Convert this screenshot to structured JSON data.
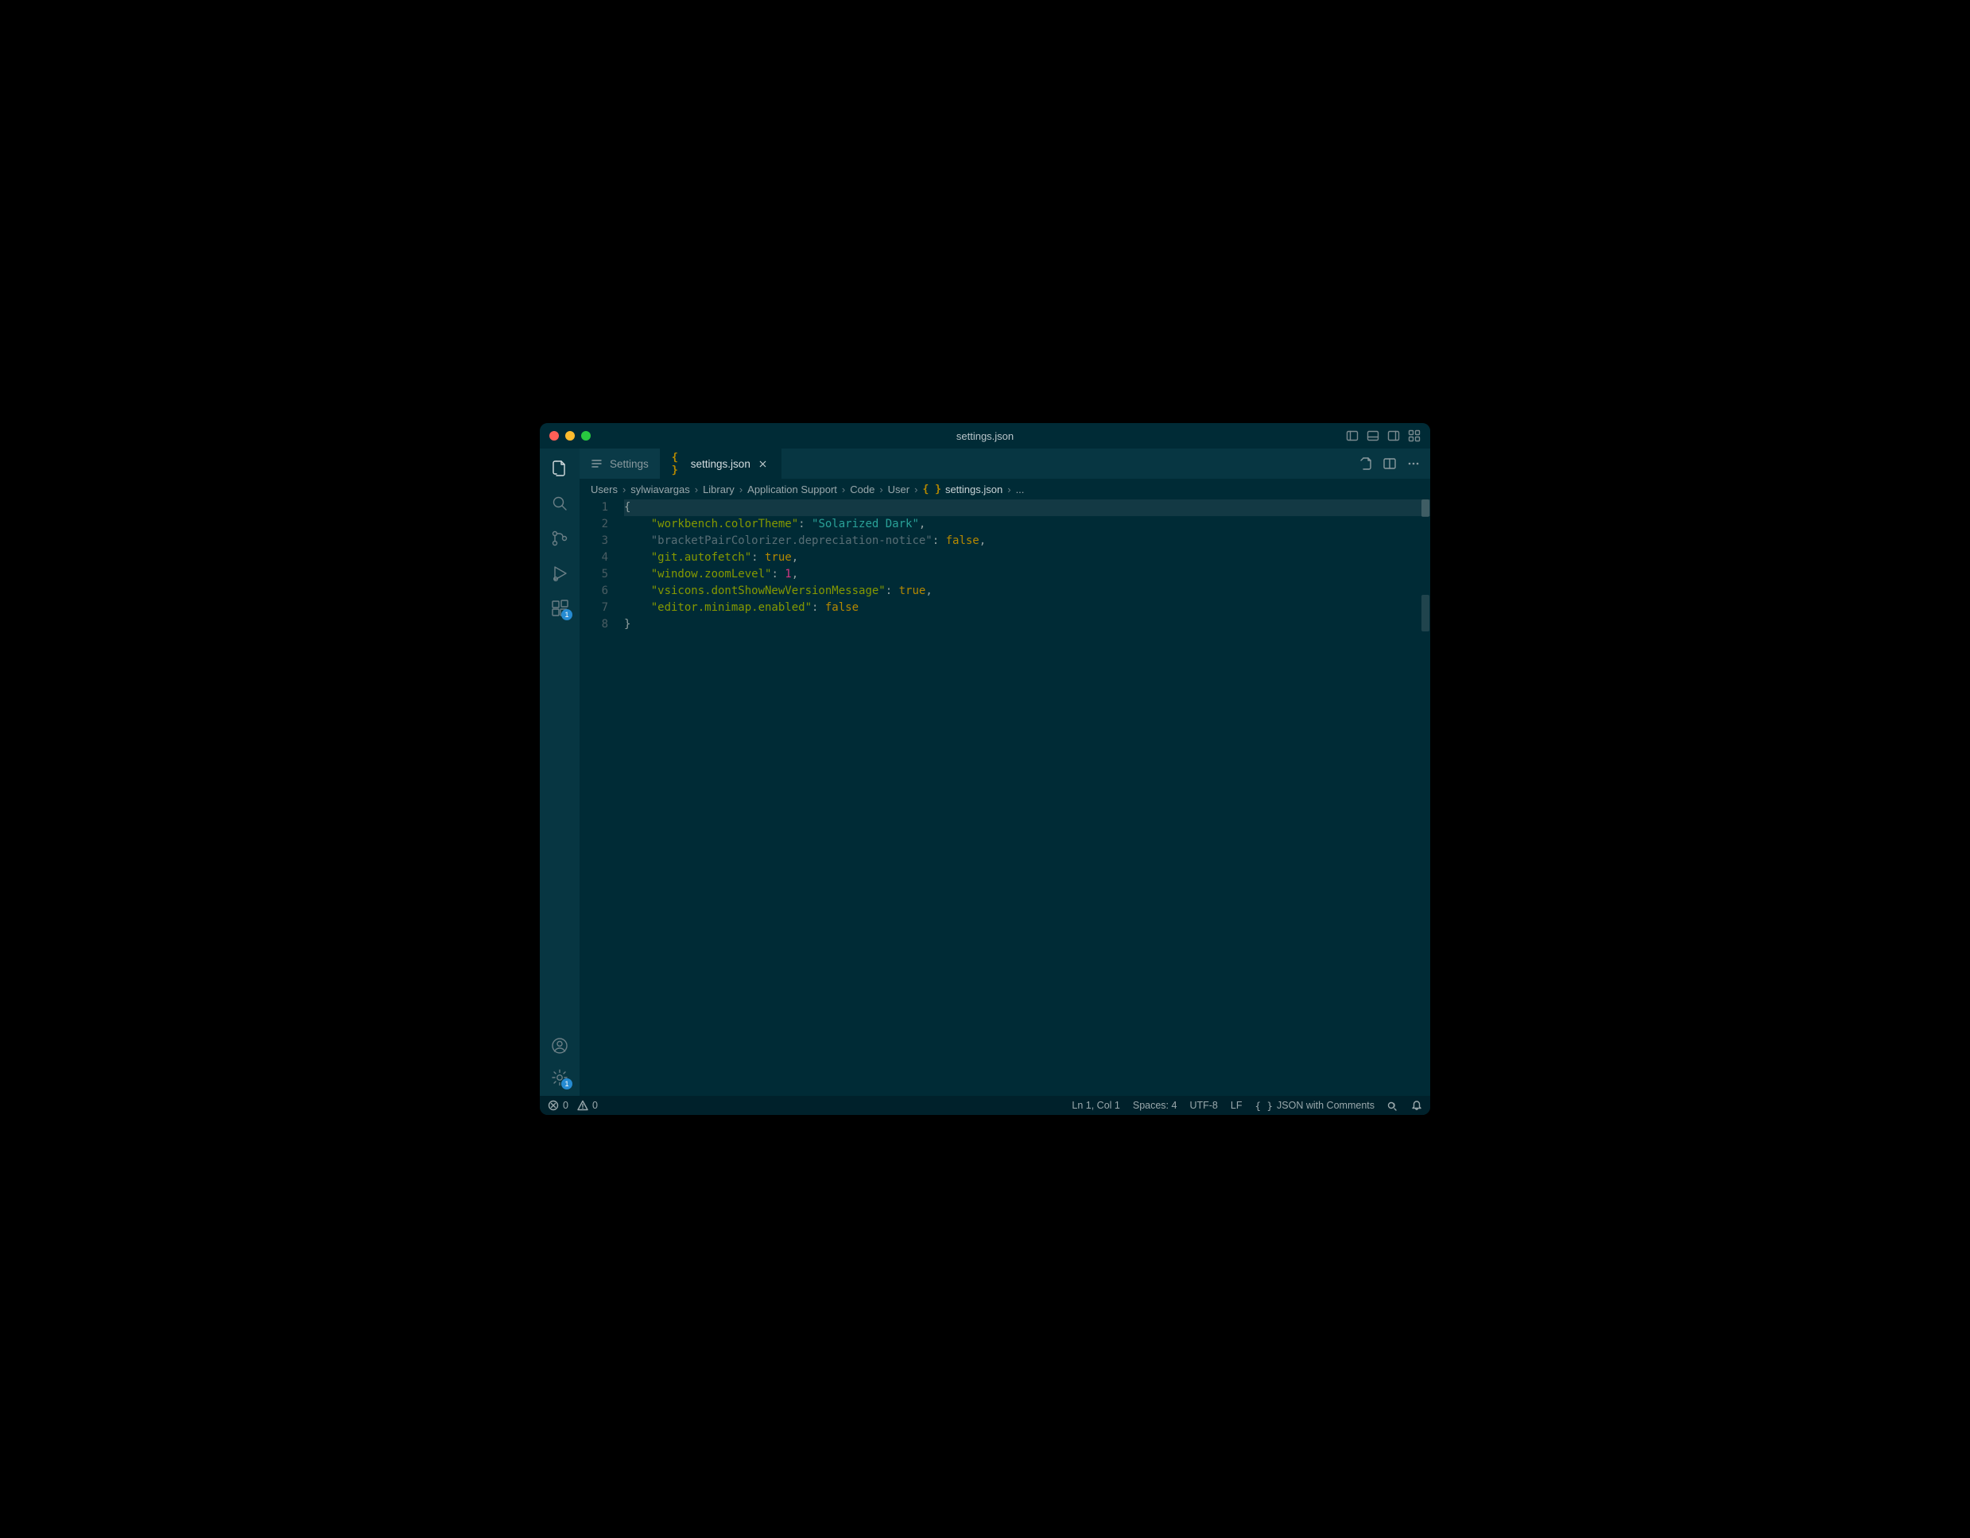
{
  "titlebar": {
    "title": "settings.json"
  },
  "tabs": [
    {
      "label": "Settings",
      "icon": "settings-list"
    },
    {
      "label": "settings.json",
      "icon": "json-braces"
    }
  ],
  "breadcrumbs": {
    "parts": [
      "Users",
      "sylwiavargas",
      "Library",
      "Application Support",
      "Code",
      "User"
    ],
    "file": "settings.json",
    "trailing": "..."
  },
  "activity": {
    "extensions_badge": "1",
    "settings_badge": "1"
  },
  "editor": {
    "lines": [
      "1",
      "2",
      "3",
      "4",
      "5",
      "6",
      "7",
      "8"
    ],
    "content": [
      {
        "key": "workbench.colorTheme",
        "type": "string",
        "value": "Solarized Dark",
        "comma": true
      },
      {
        "key": "bracketPairColorizer.depreciation-notice",
        "type": "bool",
        "value": "false",
        "comma": true,
        "dim": true
      },
      {
        "key": "git.autofetch",
        "type": "bool",
        "value": "true",
        "comma": true
      },
      {
        "key": "window.zoomLevel",
        "type": "number",
        "value": "1",
        "comma": true
      },
      {
        "key": "vsicons.dontShowNewVersionMessage",
        "type": "bool",
        "value": "true",
        "comma": true
      },
      {
        "key": "editor.minimap.enabled",
        "type": "bool",
        "value": "false",
        "comma": false
      }
    ]
  },
  "statusbar": {
    "errors": "0",
    "warnings": "0",
    "cursor": "Ln 1, Col 1",
    "spaces": "Spaces: 4",
    "encoding": "UTF-8",
    "eol": "LF",
    "language": "JSON with Comments"
  }
}
